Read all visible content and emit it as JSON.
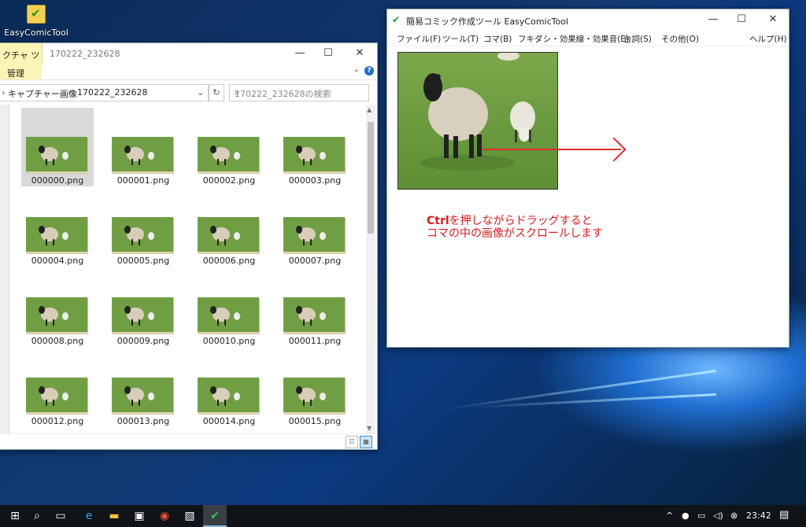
{
  "desktop": {
    "icon_label": "EasyComicTool"
  },
  "explorer": {
    "ribbon_tab": "クチャ ツール",
    "ribbon_sub": "管理",
    "title_path": "170222_232628",
    "breadcrumb": [
      "キャプチャー画像",
      "170222_232628"
    ],
    "search_placeholder": "170222_232628の検索",
    "files": [
      "000000.png",
      "000001.png",
      "000002.png",
      "000003.png",
      "000004.png",
      "000005.png",
      "000006.png",
      "000007.png",
      "000008.png",
      "000009.png",
      "000010.png",
      "000011.png",
      "000012.png",
      "000013.png",
      "000014.png",
      "000015.png"
    ],
    "selected_index": 0
  },
  "ect": {
    "title": "簡易コミック作成ツール EasyComicTool",
    "menu": [
      "ファイル(F)",
      "ツール(T)",
      "コマ(B)",
      "フキダシ・効果線・効果音(E)",
      "台詞(S)",
      "その他(O)",
      "ヘルプ(H)"
    ],
    "note_line1_bold": "Ctrl",
    "note_line1_rest": "を押しながらドラッグすると",
    "note_line2": "コマの中の画像がスクロールします"
  },
  "taskbar": {
    "clock": "23:42"
  },
  "colors": {
    "accent_red": "#e01818",
    "desktop_blue": "#123a74"
  }
}
